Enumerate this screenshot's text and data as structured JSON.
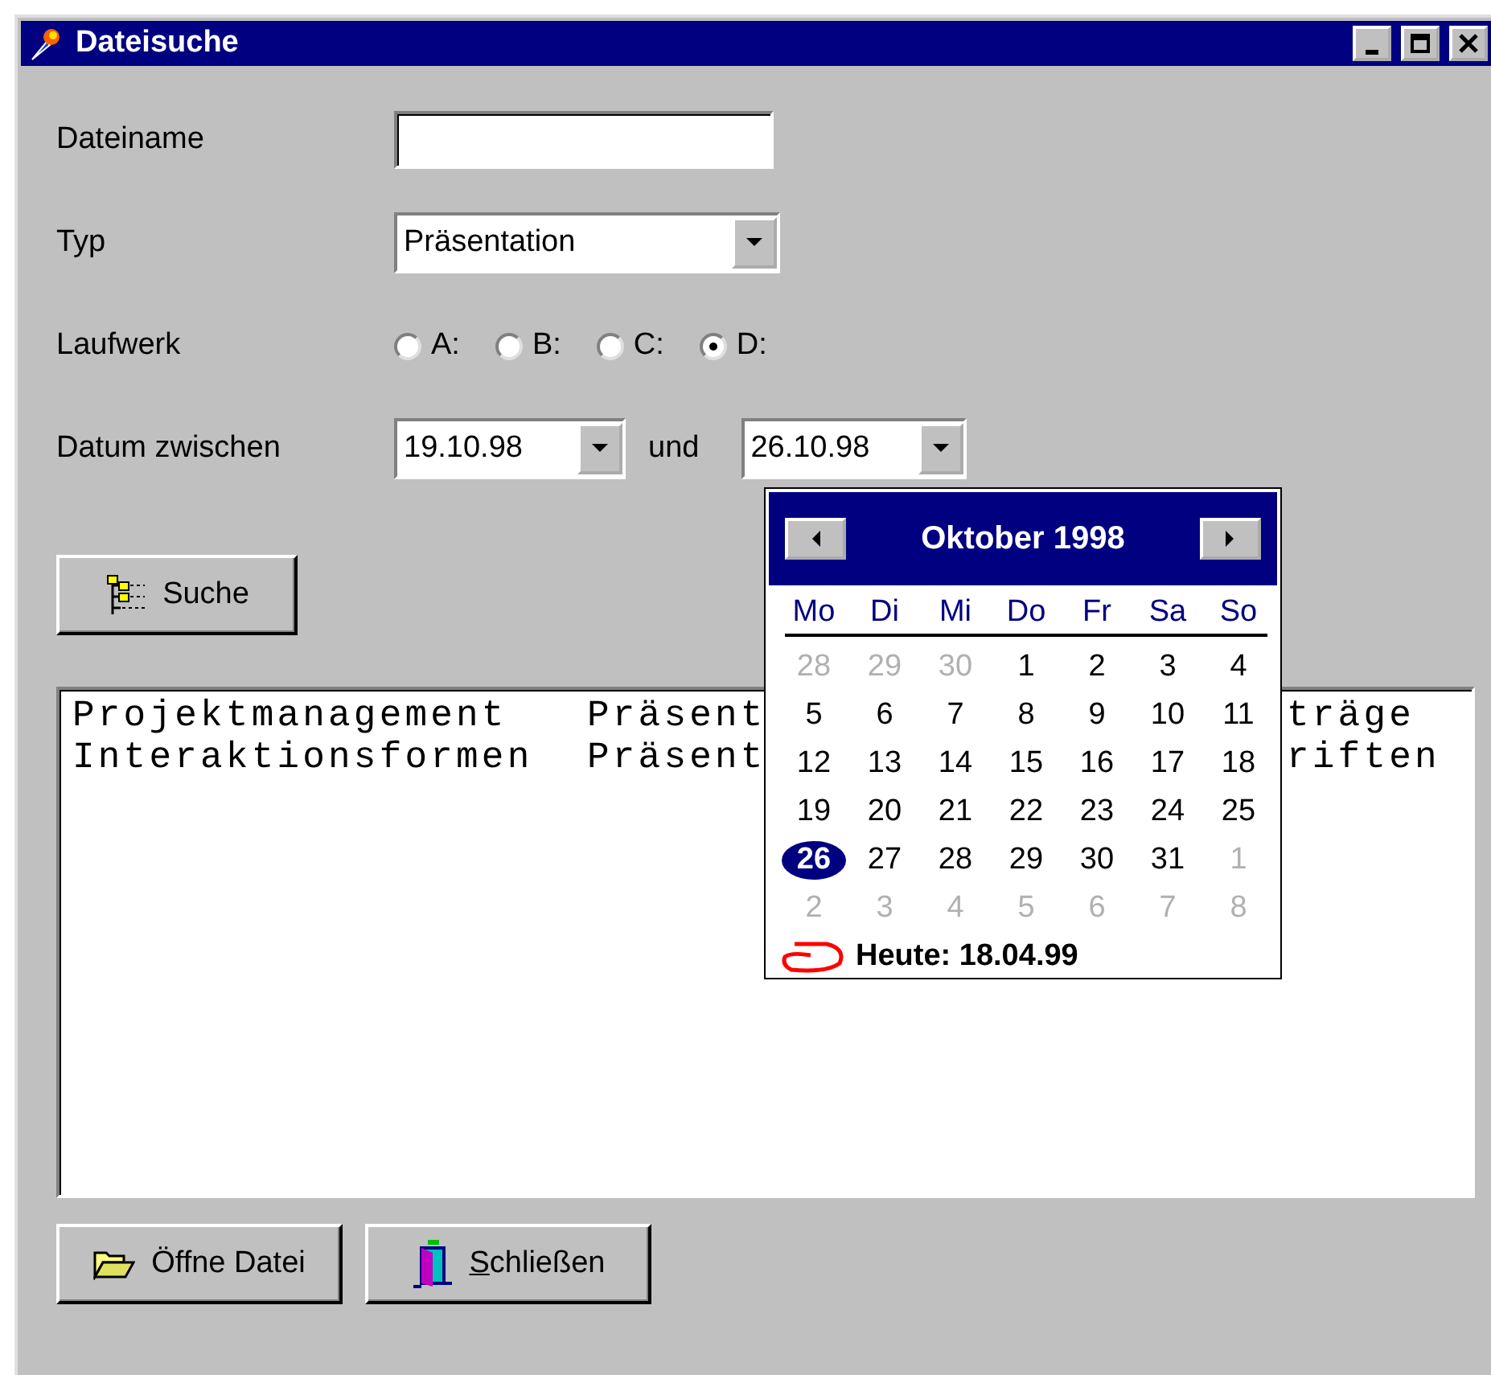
{
  "window": {
    "title": "Dateisuche"
  },
  "form": {
    "filename": {
      "label": "Dateiname"
    },
    "type": {
      "label": "Typ",
      "value": "Präsentation"
    },
    "drive": {
      "label": "Laufwerk",
      "options": [
        {
          "label": "A:",
          "selected": false
        },
        {
          "label": "B:",
          "selected": false
        },
        {
          "label": "C:",
          "selected": false
        },
        {
          "label": "D:",
          "selected": true
        }
      ]
    },
    "date_range": {
      "label": "Datum zwischen",
      "from": "19.10.98",
      "separator": "und",
      "to": "26.10.98"
    }
  },
  "search_button": {
    "label": "Suche"
  },
  "calendar": {
    "title": "Oktober 1998",
    "weekdays": [
      "Mo",
      "Di",
      "Mi",
      "Do",
      "Fr",
      "Sa",
      "So"
    ],
    "days": [
      {
        "label": "28",
        "in_month": false,
        "selected": false
      },
      {
        "label": "29",
        "in_month": false,
        "selected": false
      },
      {
        "label": "30",
        "in_month": false,
        "selected": false
      },
      {
        "label": "1",
        "in_month": true,
        "selected": false
      },
      {
        "label": "2",
        "in_month": true,
        "selected": false
      },
      {
        "label": "3",
        "in_month": true,
        "selected": false
      },
      {
        "label": "4",
        "in_month": true,
        "selected": false
      },
      {
        "label": "5",
        "in_month": true,
        "selected": false
      },
      {
        "label": "6",
        "in_month": true,
        "selected": false
      },
      {
        "label": "7",
        "in_month": true,
        "selected": false
      },
      {
        "label": "8",
        "in_month": true,
        "selected": false
      },
      {
        "label": "9",
        "in_month": true,
        "selected": false
      },
      {
        "label": "10",
        "in_month": true,
        "selected": false
      },
      {
        "label": "11",
        "in_month": true,
        "selected": false
      },
      {
        "label": "12",
        "in_month": true,
        "selected": false
      },
      {
        "label": "13",
        "in_month": true,
        "selected": false
      },
      {
        "label": "14",
        "in_month": true,
        "selected": false
      },
      {
        "label": "15",
        "in_month": true,
        "selected": false
      },
      {
        "label": "16",
        "in_month": true,
        "selected": false
      },
      {
        "label": "17",
        "in_month": true,
        "selected": false
      },
      {
        "label": "18",
        "in_month": true,
        "selected": false
      },
      {
        "label": "19",
        "in_month": true,
        "selected": false
      },
      {
        "label": "20",
        "in_month": true,
        "selected": false
      },
      {
        "label": "21",
        "in_month": true,
        "selected": false
      },
      {
        "label": "22",
        "in_month": true,
        "selected": false
      },
      {
        "label": "23",
        "in_month": true,
        "selected": false
      },
      {
        "label": "24",
        "in_month": true,
        "selected": false
      },
      {
        "label": "25",
        "in_month": true,
        "selected": false
      },
      {
        "label": "26",
        "in_month": true,
        "selected": true
      },
      {
        "label": "27",
        "in_month": true,
        "selected": false
      },
      {
        "label": "28",
        "in_month": true,
        "selected": false
      },
      {
        "label": "29",
        "in_month": true,
        "selected": false
      },
      {
        "label": "30",
        "in_month": true,
        "selected": false
      },
      {
        "label": "31",
        "in_month": true,
        "selected": false
      },
      {
        "label": "1",
        "in_month": false,
        "selected": false
      },
      {
        "label": "2",
        "in_month": false,
        "selected": false
      },
      {
        "label": "3",
        "in_month": false,
        "selected": false
      },
      {
        "label": "4",
        "in_month": false,
        "selected": false
      },
      {
        "label": "5",
        "in_month": false,
        "selected": false
      },
      {
        "label": "6",
        "in_month": false,
        "selected": false
      },
      {
        "label": "7",
        "in_month": false,
        "selected": false
      },
      {
        "label": "8",
        "in_month": false,
        "selected": false
      }
    ],
    "today": "Heute: 18.04.99"
  },
  "results": [
    {
      "column_1": "Projektmanagement",
      "column_2": "Präsent",
      "column_3": "träge"
    },
    {
      "column_1": "Interaktionsformen",
      "column_2": "Präsent",
      "column_3": "riften"
    }
  ],
  "buttons": [
    {
      "label": "Öffne Datei",
      "kind": "open",
      "mnemonic": false
    },
    {
      "label": "Schließen",
      "kind": "close",
      "mnemonic": true
    }
  ]
}
